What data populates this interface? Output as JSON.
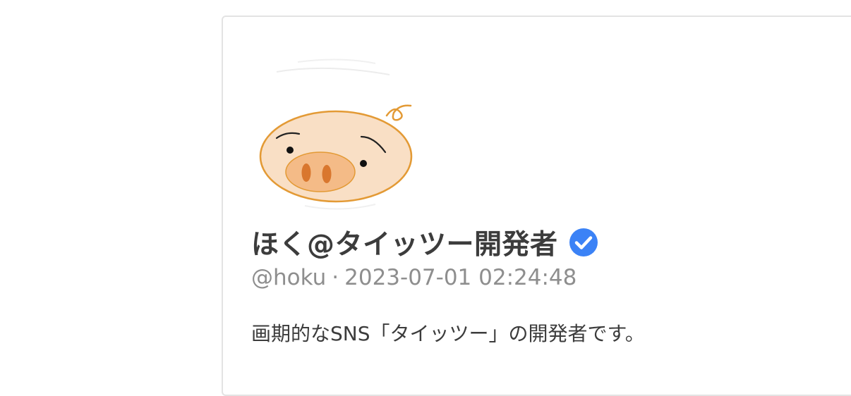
{
  "profile": {
    "avatar_icon": "pig-face-icon",
    "display_name": "ほく@タイッツー開発者",
    "verified_icon": "verified-check-icon",
    "handle": "@hoku",
    "separator": "·",
    "timestamp": "2023-07-01 02:24:48",
    "bio": "画期的なSNS「タイッツー」の開発者です。"
  },
  "colors": {
    "verified": "#3b82f6",
    "pig_fill": "#f9dfc5",
    "pig_outline": "#e39a35",
    "snout_fill": "#f4bb87",
    "nostril": "#d9772e"
  }
}
